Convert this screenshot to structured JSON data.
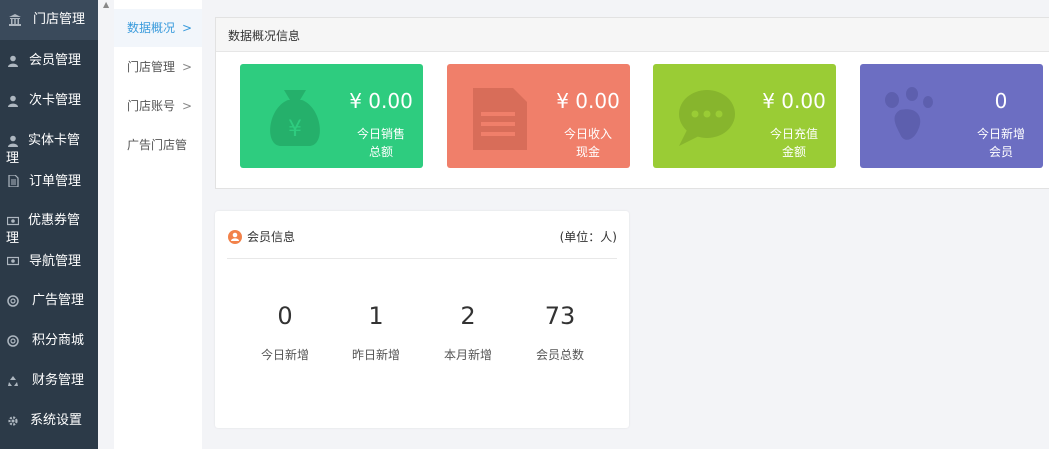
{
  "sidebar": {
    "items": [
      {
        "label": "门店管理",
        "icon": "bank-icon"
      },
      {
        "label": "会员管理",
        "icon": "user-icon"
      },
      {
        "label": "次卡管理",
        "icon": "user-icon"
      },
      {
        "label": "实体卡管理",
        "icon": "user-icon"
      },
      {
        "label": "订单管理",
        "icon": "document-icon"
      },
      {
        "label": "优惠券管理",
        "icon": "money-icon"
      },
      {
        "label": "导航管理",
        "icon": "money-icon"
      },
      {
        "label": "广告管理",
        "icon": "lifebuoy-icon"
      },
      {
        "label": "积分商城",
        "icon": "lifebuoy-icon"
      },
      {
        "label": "财务管理",
        "icon": "recycle-icon"
      },
      {
        "label": "系统设置",
        "icon": "gear-icon"
      }
    ]
  },
  "subnav": {
    "items": [
      {
        "label": "数据概况",
        "arrow": ">"
      },
      {
        "label": "门店管理",
        "arrow": ">"
      },
      {
        "label": "门店账号",
        "arrow": ">"
      },
      {
        "label": "广告门店管",
        "arrow": ""
      }
    ]
  },
  "overview": {
    "title": "数据概况信息",
    "cards": [
      {
        "value": "¥ 0.00",
        "label_line1": "今日销售",
        "label_line2": "总额",
        "color": "#2ecc7f",
        "icon": "money-bag-icon"
      },
      {
        "value": "¥ 0.00",
        "label_line1": "今日收入",
        "label_line2": "现金",
        "color": "#f07f6a",
        "icon": "document-icon"
      },
      {
        "value": "¥ 0.00",
        "label_line1": "今日充值",
        "label_line2": "金额",
        "color": "#9acc35",
        "icon": "chat-bubble-icon"
      },
      {
        "value": "0",
        "label_line1": "今日新增",
        "label_line2": "会员",
        "color": "#6c6ec2",
        "icon": "footprint-icon"
      }
    ]
  },
  "member": {
    "title": "会员信息",
    "unit": "(单位：人)",
    "stats": [
      {
        "value": "0",
        "label": "今日新增"
      },
      {
        "value": "1",
        "label": "昨日新增"
      },
      {
        "value": "2",
        "label": "本月新增"
      },
      {
        "value": "73",
        "label": "会员总数"
      }
    ]
  }
}
